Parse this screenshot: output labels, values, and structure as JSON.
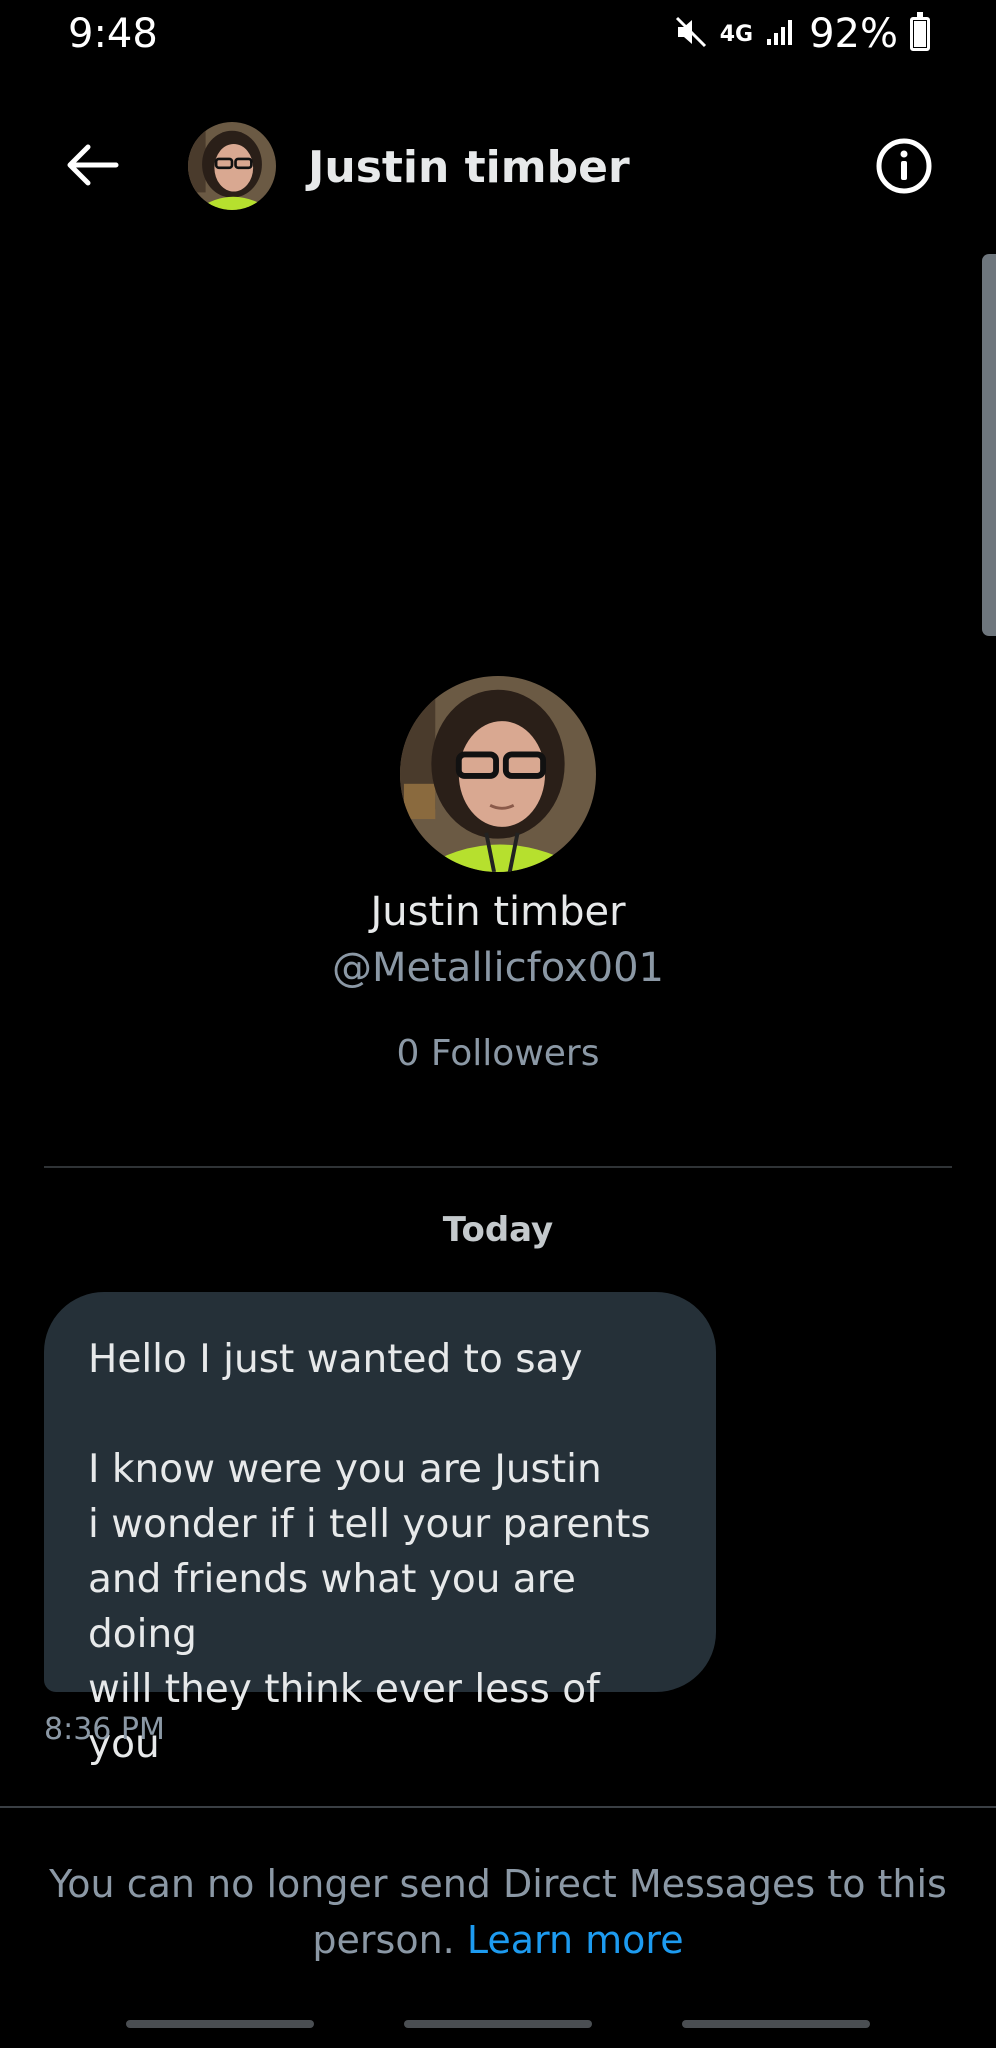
{
  "status_bar": {
    "time": "9:48",
    "network": "4G",
    "battery_percent": "92%",
    "battery_level": 0.92
  },
  "header": {
    "title": "Justin timber",
    "back_icon": "arrow-left-icon",
    "info_icon": "info-circle-icon"
  },
  "profile": {
    "name": "Justin timber",
    "handle": "@Metallicfox001",
    "followers": "0 Followers"
  },
  "conversation": {
    "day_label": "Today",
    "messages": [
      {
        "text": "Hello I just wanted to say\n\nI know were you are Justin\ni wonder if i tell your parents\nand friends what you are doing\nwill they think ever less of you",
        "time": "8:36 PM"
      }
    ]
  },
  "footer": {
    "notice_text": "You can no longer send Direct Messages to this person.",
    "learn_more": "Learn more"
  },
  "colors": {
    "background": "#000000",
    "bubble": "#253038",
    "accent": "#1d9bf0",
    "secondary_text": "#8b98a5"
  }
}
